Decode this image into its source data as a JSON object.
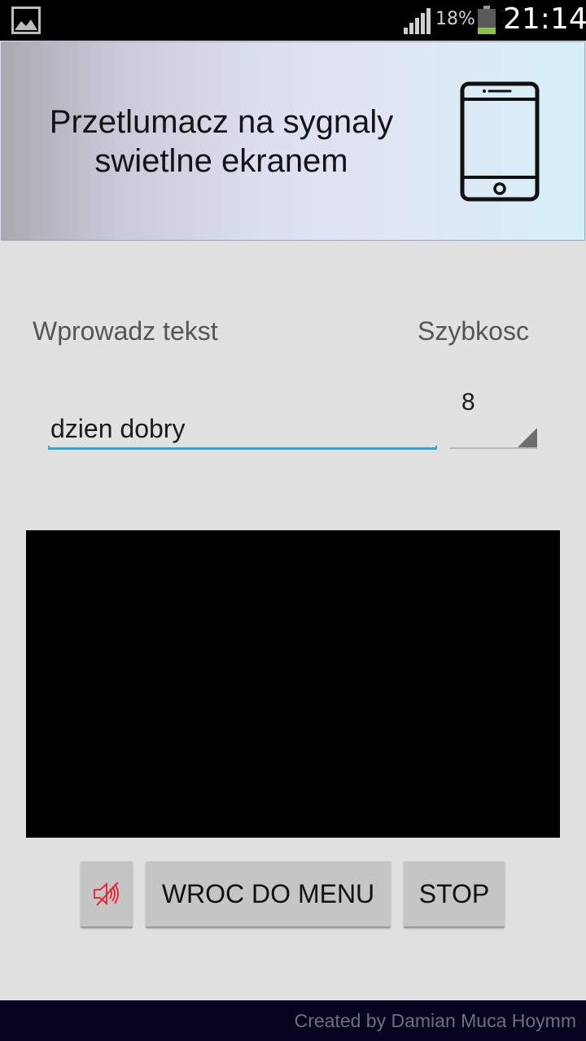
{
  "status_bar": {
    "battery_percent": "18%",
    "clock": "21:14",
    "icons": [
      "gallery-icon",
      "signal-icon",
      "battery-icon"
    ],
    "battery_level": 0.18,
    "battery_color": "#8bc34a"
  },
  "header": {
    "title": "Przetlumacz na sygnaly swietlne ekranem",
    "icon": "smartphone-icon"
  },
  "form": {
    "text_label": "Wprowadz tekst",
    "speed_label": "Szybkosc",
    "text_value": "dzien dobry",
    "speed_value": "8",
    "accent_color": "#33a6d9"
  },
  "buttons": {
    "sound_icon": "sound-off-icon",
    "menu_label": "WROC DO MENU",
    "stop_label": "STOP",
    "sound_icon_color": "#e8202a"
  },
  "footer": {
    "credit": "Created by Damian Muca Hoymm"
  }
}
